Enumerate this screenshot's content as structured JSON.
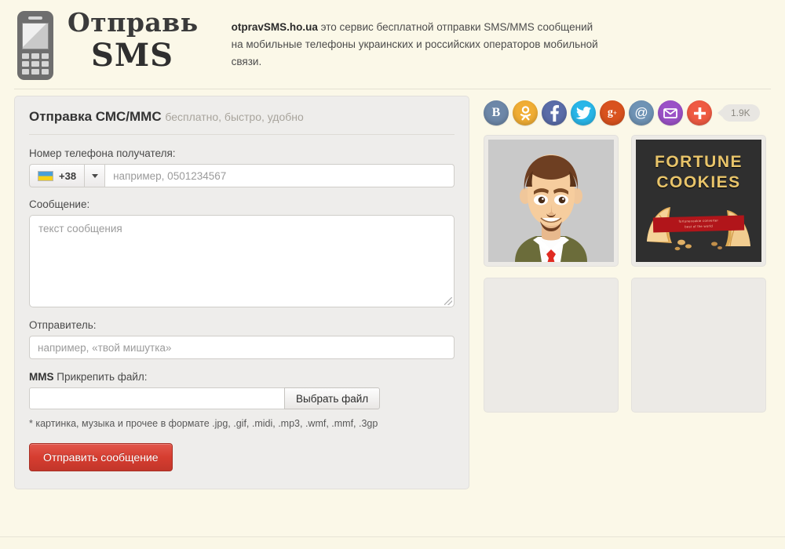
{
  "header": {
    "logo_line1": "Отправь",
    "logo_line2": "SMS",
    "phone_icon": "mobile-phone-icon",
    "desc_brand": "otpravSMS.ho.ua",
    "desc_text": " это сервис бесплатной отправки SMS/MMS сообщений на мобильные телефоны украинских и российских операторов мобильной связи."
  },
  "form": {
    "title": "Отправка СМС/ММС",
    "title_sub": "бесплатно, быстро, удобно",
    "phone_label": "Номер телефона получателя:",
    "country_code": "+38",
    "country_flag": "ukraine-flag-icon",
    "phone_placeholder": "например, 0501234567",
    "phone_value": "",
    "message_label": "Сообщение:",
    "message_placeholder": "текст сообщения",
    "message_value": "",
    "sender_label": "Отправитель:",
    "sender_placeholder": "например, «твой мишутка»",
    "sender_value": "",
    "mms_label_strong": "MMS",
    "mms_label_rest": " Прикрепить файл:",
    "file_value": "",
    "file_button": "Выбрать файл",
    "file_note": "* картинка, музыка и прочее в формате .jpg, .gif, .midi, .mp3, .wmf, .mmf, .3gp",
    "submit_button": "Отправить сообщение",
    "submit_color": "#d63d30"
  },
  "social": {
    "count": "1.9K",
    "buttons": [
      {
        "name": "vkontakte",
        "label": "В",
        "color": "#6d87a8"
      },
      {
        "name": "odnoklassniki",
        "label": "ОК",
        "color": "#f0ad34"
      },
      {
        "name": "facebook",
        "label": "f",
        "color": "#5a6ca8"
      },
      {
        "name": "twitter",
        "label": "bird",
        "color": "#29b6e8"
      },
      {
        "name": "google-plus",
        "label": "g+",
        "color": "#d9521e"
      },
      {
        "name": "at-sign",
        "label": "@",
        "color": "#6f93b5"
      },
      {
        "name": "email",
        "label": "envelope",
        "color": "#9b51c7"
      },
      {
        "name": "share-more",
        "label": "+",
        "color": "#ef5a42"
      }
    ]
  },
  "thumbs": [
    {
      "name": "avatar-thumbnail",
      "alt": "Мультипликационный аватар мужчины"
    },
    {
      "name": "fortune-cookies-banner",
      "title_line1": "FORTUNE",
      "title_line2": "COOKIES",
      "ribbon_line1": "fortunecookie converter",
      "ribbon_line2": "best of the world"
    }
  ],
  "placeholders": [
    {
      "name": "ad-placeholder-left"
    },
    {
      "name": "ad-placeholder-right"
    }
  ]
}
